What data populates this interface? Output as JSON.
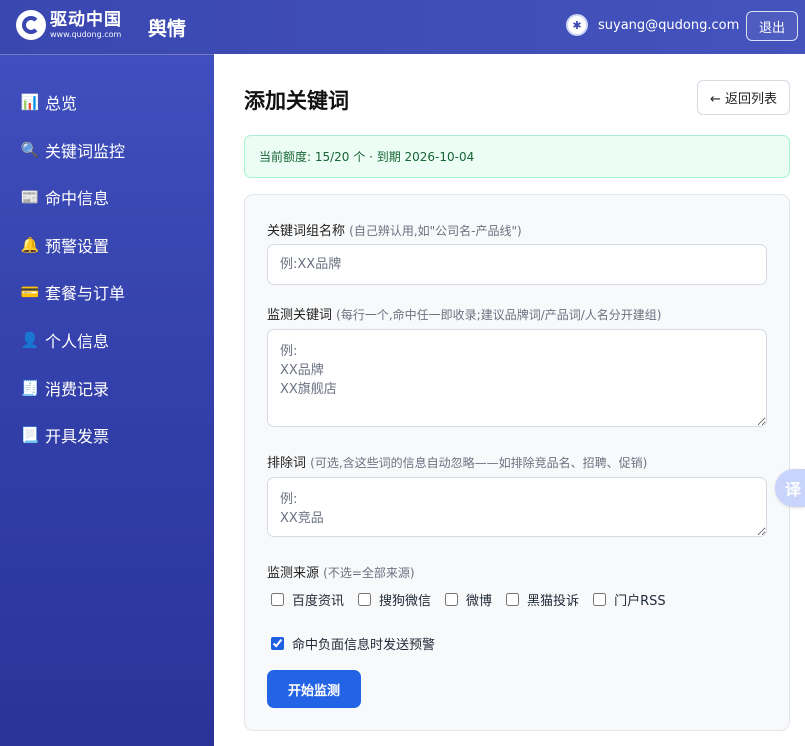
{
  "header": {
    "logo_cn": "驱动中国",
    "logo_url": "www.qudong.com",
    "brand_sub": "舆情",
    "user_email": "suyang@qudong.com",
    "logout_label": "退出"
  },
  "sidebar": {
    "items": [
      {
        "icon": "📊",
        "icon_name": "chart-icon",
        "label": "总览"
      },
      {
        "icon": "🔍",
        "icon_name": "search-icon",
        "label": "关键词监控"
      },
      {
        "icon": "📰",
        "icon_name": "newspaper-icon",
        "label": "命中信息"
      },
      {
        "icon": "🔔",
        "icon_name": "bell-icon",
        "label": "预警设置"
      },
      {
        "icon": "💳",
        "icon_name": "credit-card-icon",
        "label": "套餐与订单"
      },
      {
        "icon": "👤",
        "icon_name": "user-icon",
        "label": "个人信息"
      },
      {
        "icon": "🧾",
        "icon_name": "ledger-icon",
        "label": "消费记录"
      },
      {
        "icon": "📃",
        "icon_name": "invoice-icon",
        "label": "开具发票"
      }
    ]
  },
  "main": {
    "title": "添加关键词",
    "back_label": "← 返回列表",
    "quota_text": "当前额度: 15/20 个 · 到期 2026-10-04"
  },
  "form": {
    "group_name": {
      "label": "关键词组名称",
      "hint": "(自己辨认用,如\"公司名-产品线\")",
      "value": "",
      "placeholder": "例:XX品牌"
    },
    "keywords": {
      "label": "监测关键词",
      "hint": "(每行一个,命中任一即收录;建议品牌词/产品词/人名分开建组)",
      "value": "",
      "placeholder": "例:\nXX品牌\nXX旗舰店"
    },
    "exclude": {
      "label": "排除词",
      "hint": "(可选,含这些词的信息自动忽略——如排除竞品名、招聘、促销)",
      "value": "",
      "placeholder": "例:\nXX竞品"
    },
    "sources": {
      "label": "监测来源",
      "hint": "(不选=全部来源)",
      "options": [
        {
          "label": "百度资讯",
          "checked": false
        },
        {
          "label": "搜狗微信",
          "checked": false
        },
        {
          "label": "微博",
          "checked": false
        },
        {
          "label": "黑猫投诉",
          "checked": false
        },
        {
          "label": "门户RSS",
          "checked": false
        }
      ]
    },
    "negative_alert": {
      "label": "命中负面信息时发送预警",
      "checked": true
    },
    "submit_label": "开始监测"
  },
  "translate_widget": {
    "label": "译"
  },
  "colors": {
    "header_bg": "#3a47b0",
    "sidebar_bg": "#323ea8",
    "primary_button": "#2363e5",
    "quota_bg": "#ecfdf5",
    "quota_text": "#166534"
  }
}
